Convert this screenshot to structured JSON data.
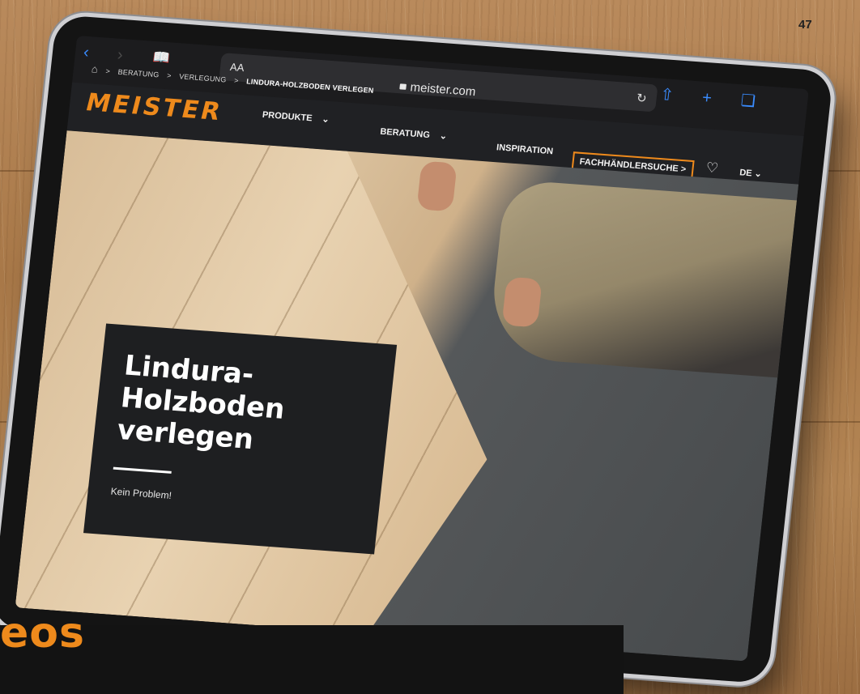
{
  "page_number": "47",
  "section_heading_fragment": "eos",
  "safari": {
    "text_size_label": "AA",
    "url": "meister.com"
  },
  "breadcrumb": {
    "items": [
      "Beratung",
      "Verlegung"
    ],
    "current": "Lindura-Holzboden verlegen",
    "separator": ">"
  },
  "site": {
    "logo": "MEISTER",
    "nav": {
      "produkte": "PRODUKTE",
      "beratung": "BERATUNG",
      "inspiration": "INSPIRATION",
      "dealer": "FACHHÄNDLERSUCHE >",
      "language": "DE"
    }
  },
  "hero": {
    "title": "Lindura-Holzboden verlegen",
    "subtitle": "Kein Problem!"
  },
  "colors": {
    "brand_orange": "#ee8a1c",
    "nav_bg": "#202124",
    "safari_accent": "#3a8cff"
  },
  "icons": [
    "back-icon",
    "forward-icon",
    "bookmarks-icon",
    "lock-icon",
    "reload-icon",
    "share-icon",
    "new-tab-icon",
    "tabs-icon",
    "home-icon",
    "chevron-down-icon",
    "heart-icon"
  ]
}
